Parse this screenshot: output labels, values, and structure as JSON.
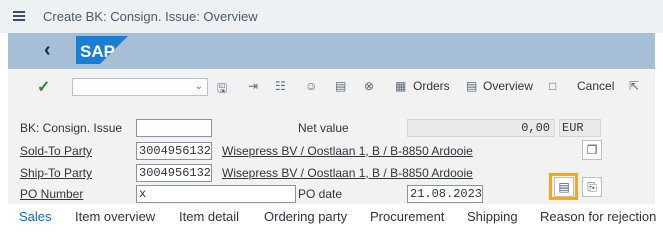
{
  "window": {
    "title": "Create BK: Consign. Issue: Overview"
  },
  "toolbar": {
    "command_field": "",
    "orders_label": "Orders",
    "overview_label": "Overview",
    "cancel_label": "Cancel"
  },
  "header": {
    "order_type_label": "BK: Consign. Issue",
    "order_type_value": "",
    "net_value_label": "Net value",
    "net_value": "0,00",
    "currency": "EUR",
    "sold_to_label": "Sold-To Party",
    "sold_to_value": "3004956132",
    "sold_to_address": "Wisepress BV / Oostlaan 1, B / B-8850 Ardooie",
    "ship_to_label": "Ship-To Party",
    "ship_to_value": "3004956132",
    "ship_to_address": "Wisepress BV / Oostlaan 1, B / B-8850 Ardooie",
    "po_number_label": "PO Number",
    "po_number_value": "x",
    "po_date_label": "PO date",
    "po_date_value": "21.08.2023"
  },
  "tabs": [
    {
      "label": "Sales"
    },
    {
      "label": "Item overview"
    },
    {
      "label": "Item detail"
    },
    {
      "label": "Ordering party"
    },
    {
      "label": "Procurement"
    },
    {
      "label": "Shipping"
    },
    {
      "label": "Reason for rejection"
    }
  ],
  "colors": {
    "shell": "#a6bfd6",
    "accent": "#0a6ed1",
    "highlight": "#f5a623",
    "check": "#2b8a2b"
  }
}
